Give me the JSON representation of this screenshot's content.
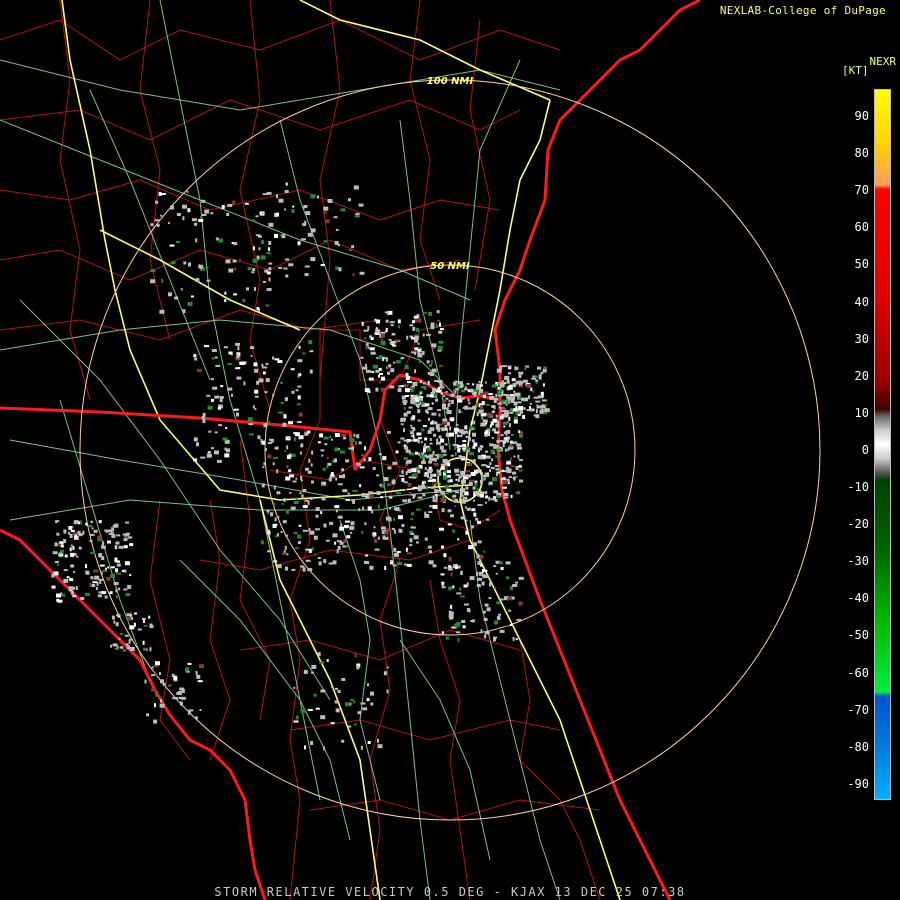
{
  "header": {
    "credit": "NEXLAB-College of DuPage",
    "product": "NEXR",
    "units": "[KT]"
  },
  "caption": "STORM RELATIVE VELOCITY 0.5 DEG - KJAX 13 DEC 25 07:38",
  "map": {
    "radar_site": "KJAX",
    "range_rings": [
      {
        "label": "100 NMI"
      },
      {
        "label": "50 NMI"
      }
    ],
    "colors": {
      "background": "#000000",
      "county_lines": "#b31414",
      "state_lines": "#ff1a1a",
      "highways": "#ffff66",
      "roads": "#8fe39a",
      "range_rings": "#ffd0a0"
    }
  },
  "legend": {
    "unit": "KT",
    "ticks": [
      "90",
      "80",
      "70",
      "60",
      "50",
      "40",
      "30",
      "20",
      "10",
      "0",
      "-10",
      "-20",
      "-30",
      "-40",
      "-50",
      "-60",
      "-70",
      "-80",
      "-90"
    ]
  }
}
